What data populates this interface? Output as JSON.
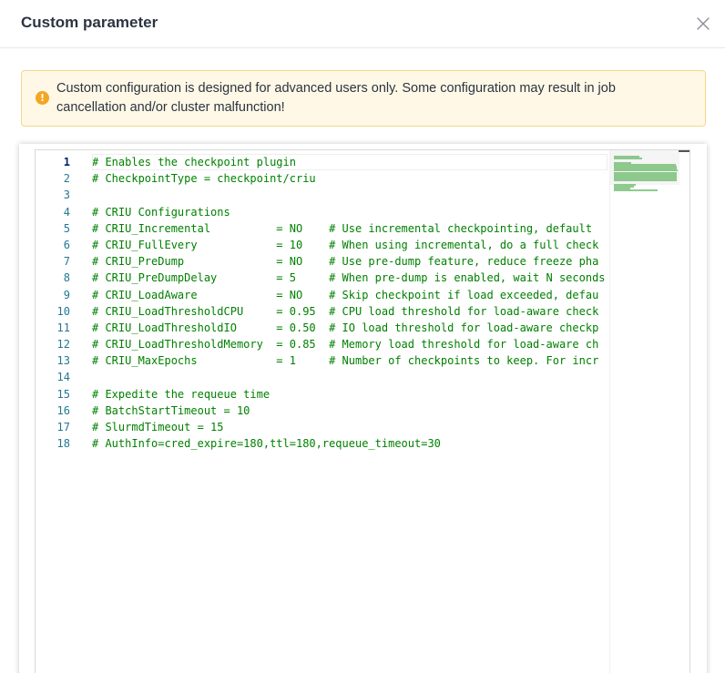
{
  "dialog": {
    "title": "Custom parameter",
    "close_icon": "close-icon"
  },
  "warning": {
    "icon": "warning-icon",
    "text": "Custom configuration is designed for advanced users only. Some configuration may result in job cancellation and/or cluster malfunction!",
    "colors": {
      "background": "#fff8e6",
      "border": "#f5d68f",
      "icon": "#f4a623"
    }
  },
  "editor": {
    "active_line": 1,
    "comment_color": "#008000",
    "line_number_color": "#237893",
    "lines": [
      "# Enables the checkpoint plugin",
      "# CheckpointType = checkpoint/criu",
      "",
      "# CRIU Configurations",
      "# CRIU_Incremental          = NO    # Use incremental checkpointing, default",
      "# CRIU_FullEvery            = 10    # When using incremental, do a full check",
      "# CRIU_PreDump              = NO    # Use pre-dump feature, reduce freeze pha",
      "# CRIU_PreDumpDelay         = 5     # When pre-dump is enabled, wait N seconds",
      "# CRIU_LoadAware            = NO    # Skip checkpoint if load exceeded, defau",
      "# CRIU_LoadThresholdCPU     = 0.95  # CPU load threshold for load-aware check",
      "# CRIU_LoadThresholdIO      = 0.50  # IO load threshold for load-aware checkp",
      "# CRIU_LoadThresholdMemory  = 0.85  # Memory load threshold for load-aware ch",
      "# CRIU_MaxEpochs            = 1     # Number of checkpoints to keep. For incr",
      "",
      "# Expedite the requeue time",
      "# BatchStartTimeout = 10",
      "# SlurmdTimeout = 15",
      "# AuthInfo=cred_expire=180,ttl=180,requeue_timeout=30"
    ]
  }
}
